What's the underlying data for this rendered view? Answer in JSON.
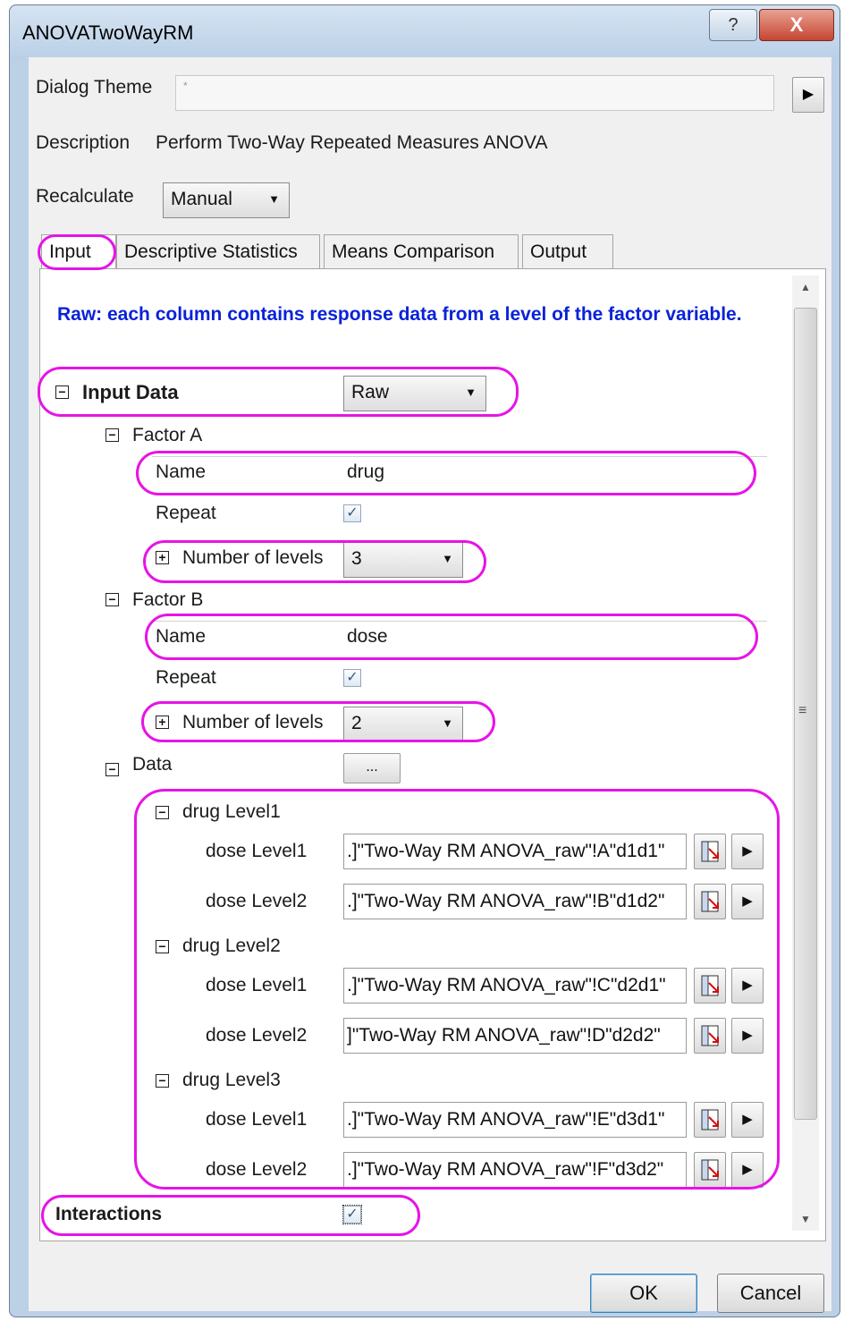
{
  "window": {
    "title": "ANOVATwoWayRM",
    "help_label": "?",
    "close_label": "X"
  },
  "dialog_theme": {
    "label": "Dialog Theme",
    "value": "*"
  },
  "description": {
    "label": "Description",
    "value": "Perform Two-Way Repeated Measures ANOVA"
  },
  "recalculate": {
    "label": "Recalculate",
    "value": "Manual"
  },
  "tabs": [
    {
      "label": "Input",
      "selected": true
    },
    {
      "label": "Descriptive Statistics"
    },
    {
      "label": "Means Comparison"
    },
    {
      "label": "Output"
    }
  ],
  "hint": "Raw: each column contains response data from a level of the factor variable.",
  "input_data": {
    "label": "Input Data",
    "value": "Raw"
  },
  "factor_a": {
    "label": "Factor A",
    "name_label": "Name",
    "name_value": "drug",
    "repeat_label": "Repeat",
    "repeat_checked": true,
    "levels_label": "Number of levels",
    "levels_value": "3"
  },
  "factor_b": {
    "label": "Factor B",
    "name_label": "Name",
    "name_value": "dose",
    "repeat_label": "Repeat",
    "repeat_checked": true,
    "levels_label": "Number of levels",
    "levels_value": "2"
  },
  "data": {
    "label": "Data",
    "button_label": "...",
    "groups": [
      {
        "label": "drug Level1",
        "rows": [
          {
            "label": "dose Level1",
            "value": ".]\"Two-Way RM ANOVA_raw\"!A\"d1d1\""
          },
          {
            "label": "dose Level2",
            "value": ".]\"Two-Way RM ANOVA_raw\"!B\"d1d2\""
          }
        ]
      },
      {
        "label": "drug Level2",
        "rows": [
          {
            "label": "dose Level1",
            "value": ".]\"Two-Way RM ANOVA_raw\"!C\"d2d1\""
          },
          {
            "label": "dose Level2",
            "value": "]\"Two-Way RM ANOVA_raw\"!D\"d2d2\""
          }
        ]
      },
      {
        "label": "drug Level3",
        "rows": [
          {
            "label": "dose Level1",
            "value": ".]\"Two-Way RM ANOVA_raw\"!E\"d3d1\""
          },
          {
            "label": "dose Level2",
            "value": ".]\"Two-Way RM ANOVA_raw\"!F\"d3d2\""
          }
        ]
      }
    ]
  },
  "interactions": {
    "label": "Interactions",
    "checked": true
  },
  "buttons": {
    "ok": "OK",
    "cancel": "Cancel"
  },
  "colors": {
    "highlight": "#e614e6",
    "hint": "#0a22d8"
  }
}
